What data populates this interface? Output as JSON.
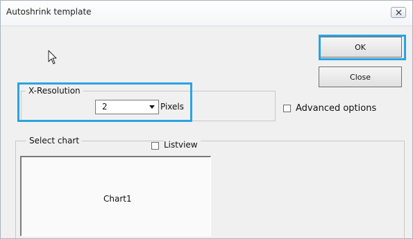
{
  "window": {
    "title": "Autoshrink template"
  },
  "buttons": {
    "ok_label": "OK",
    "close_label": "Close"
  },
  "x_resolution": {
    "legend": "X-Resolution",
    "value": "2",
    "unit_label": "Pixels"
  },
  "advanced_options": {
    "label": "Advanced options",
    "checked": false
  },
  "select_chart": {
    "legend": "Select chart",
    "listview_label": "Listview",
    "listview_checked": false,
    "items": [
      "Chart1"
    ]
  },
  "colors": {
    "highlight": "#2aa3e0",
    "dialog_background": "#f0f0f0"
  },
  "icons": {
    "title_close": "close-x-icon",
    "cursor": "arrow-cursor-icon",
    "combo_dropdown": "dropdown-arrow-icon"
  }
}
